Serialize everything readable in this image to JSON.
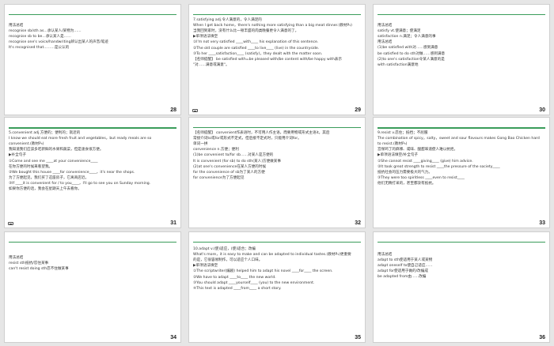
{
  "slides": [
    {
      "page": "28",
      "lines": [
        "",
        "用法总结",
        "recognise sb/sth as...承认某人/某物为……",
        "recognise sb to be...承认某人是……",
        "recognise one's voice/handwriting辨认出某人的声音/笔迹",
        "It's recognised that...……是公认的"
      ]
    },
    {
      "page": "29",
      "lines": [
        "7.satisfying adj.令人满意的，令人满足的",
        "When I get back home，there's nothing more satisfying than a big meat dinner.(教材P₃)",
        "当我回到家时，没有什么比一顿丰盛的肉类晚餐更令人满意的了。",
        "▶单项语法填空",
        "①I'm not very satisfied ____with____ his explanation of this sentence.",
        "②The old couple are satisfied ____to live____ (live) in the countryside.",
        "③To her ____satisfaction____ (satisfy)，they dealt with the matter soon.",
        "【名师提醒】 be satisfied with=be pleased with/be content with/be happy with表示",
        "\"对……满意或满意\"。"
      ]
    },
    {
      "page": "30",
      "lines": [
        "",
        "用法总结",
        "satisfy vt.使满意；使满足",
        "satisfaction n.满足；令人满意的事",
        "用法总结",
        "(1)be satisfied with对……感到满意",
        "be satisfied to do sth对做……感到满意",
        "(2)to one's satisfaction令某人满意的是",
        "with satisfaction满意地"
      ]
    },
    {
      "page": "31",
      "lines": [
        "5.convenient adj.方便的；便利的；就近的",
        "I know we should eat more fresh fruit and vegetables，but ready meals are so",
        "convenient.(教材P₃)",
        "我知道我们应该多吃新鲜的水果和蔬菜，但是速食很方便。",
        "▶补全句子",
        "①Come and see me ____at your convenience____",
        "在你方便的时候来看望我。",
        "②We bought this house ____for convenience____，it's near the shops.",
        "为了方便起见，我们买了这座房子，它离商店近。",
        "③If ____it is convenient for / to you____，I'll go to see you on Sunday morning.",
        "如果你方便的话，我会在星期天上午去看你。"
      ]
    },
    {
      "page": "32",
      "lines": [
        "【名师提醒】 convenient作表语时，不可用人作主语，而要用物或形式主语it。其后",
        "常接介词to或for或形式不定式，但后接不定式时，只能用介词for。",
        "单词一拼",
        "convenience n.方便；便利",
        "(1)be convenient to/for sb……对某人是方便的",
        "It is convenient (for sb) to do sth(某人)方便做某事",
        "(2)at one's convenience在某人方便的时候",
        "for the convenience of sb为了某人的方便",
        "for convenience为了方便起见"
      ]
    },
    {
      "page": "33",
      "lines": [
        "9.resist v.忍住；抵挡；不屈服",
        "The combination of spicy，salty，sweet and sour flavours makes Gong Bao Chicken hard",
        "to resist.(教材P₃)",
        "宫保鸡丁的麻辣、咸味、酸甜味道使人难以抗拒。",
        "▶单项语法填空/补全句子",
        "①She cannot resist ____giving____ (give) him advice.",
        "②It took great strength to resist ____the pressure of the society____",
        "抵抗社会的压力需要极大的气力。",
        "③They were too spiritless ____even to resist____",
        "他们无精打采的，甚至都没有抵抗。"
      ]
    },
    {
      "page": "34",
      "lines": [
        "",
        "用法总结",
        "resist sth抵抗/忍住某事",
        "can't resist doing sth忍不住做某事"
      ]
    },
    {
      "page": "35",
      "lines": [
        "10.adapt v.(使)适应，(使)适合；改编",
        "What's more，it is easy to make and can be adapted to individual tastes.(教材P₃)更重要",
        "的是，它很容易制作，可以适应个人口味。",
        "▶单项语法填空",
        "①The scriptwriter(编剧) helped him to adapt his novel ____for____ the screen.",
        "②We have to adapt ____to____ the new world.",
        "③You should adapt ____yourself____ (you) to the new environment.",
        "④This text is adapted ____from____ a short story."
      ]
    },
    {
      "page": "36",
      "lines": [
        "",
        "用法总结",
        "adapt to sth使适用于某人或某物",
        "adapt oneself to使自己适应……",
        "adapt for使适用于做的/改编成",
        "be adapted from由……改编"
      ]
    }
  ],
  "accent_color": "#3a9c5a",
  "highlight_color": "#c0282a",
  "corner_icon": "slide-icon"
}
